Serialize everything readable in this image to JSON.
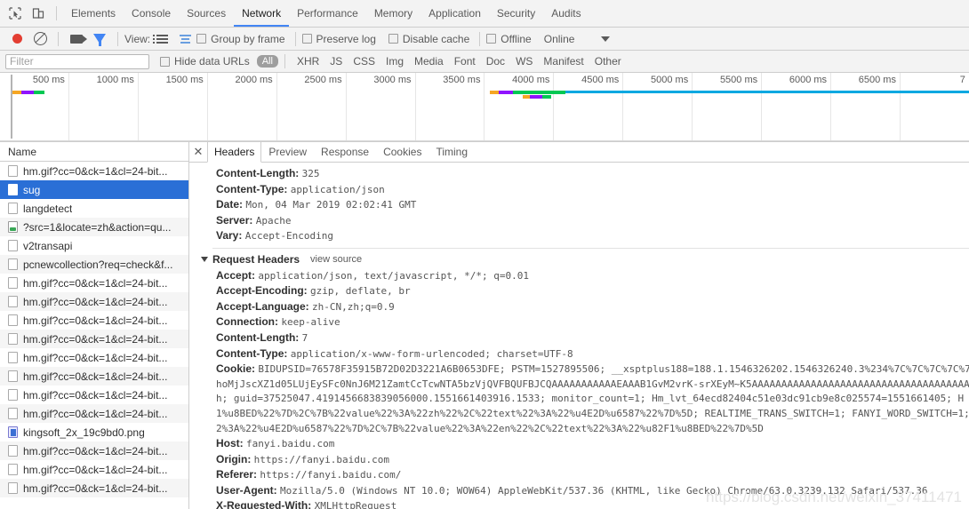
{
  "main_tabs": [
    {
      "label": "Elements",
      "active": false
    },
    {
      "label": "Console",
      "active": false
    },
    {
      "label": "Sources",
      "active": false
    },
    {
      "label": "Network",
      "active": true
    },
    {
      "label": "Performance",
      "active": false
    },
    {
      "label": "Memory",
      "active": false
    },
    {
      "label": "Application",
      "active": false
    },
    {
      "label": "Security",
      "active": false
    },
    {
      "label": "Audits",
      "active": false
    }
  ],
  "network_toolbar": {
    "record_title": "record-button",
    "clear_title": "clear-button",
    "view_label": "View:",
    "group_by_frame_label": "Group by frame",
    "preserve_log_label": "Preserve log",
    "disable_cache_label": "Disable cache",
    "offline_label": "Offline",
    "throttling_value": "Online"
  },
  "filter_bar": {
    "filter_placeholder": "Filter",
    "filter_value": "",
    "hide_data_urls_label": "Hide data URLs",
    "all_label": "All",
    "types": [
      "XHR",
      "JS",
      "CSS",
      "Img",
      "Media",
      "Font",
      "Doc",
      "WS",
      "Manifest",
      "Other"
    ]
  },
  "overview": {
    "tick_labels": [
      "500 ms",
      "1000 ms",
      "1500 ms",
      "2000 ms",
      "2500 ms",
      "3000 ms",
      "3500 ms",
      "4000 ms",
      "4500 ms",
      "5000 ms",
      "5500 ms",
      "6000 ms",
      "6500 ms",
      "7"
    ],
    "colors": {
      "orange": "#f5a623",
      "purple": "#9013fe",
      "green": "#00c853",
      "blue": "#00a8e1"
    }
  },
  "requests": {
    "column_header": "Name",
    "rows": [
      {
        "name": "hm.gif?cc=0&ck=1&cl=24-bit...",
        "icon": "file-icon",
        "selected": false
      },
      {
        "name": "sug",
        "icon": "file-icon",
        "selected": true
      },
      {
        "name": "langdetect",
        "icon": "file-icon",
        "selected": false
      },
      {
        "name": "?src=1&locate=zh&action=qu...",
        "icon": "document-icon",
        "selected": false
      },
      {
        "name": "v2transapi",
        "icon": "file-icon",
        "selected": false
      },
      {
        "name": "pcnewcollection?req=check&f...",
        "icon": "file-icon",
        "selected": false
      },
      {
        "name": "hm.gif?cc=0&ck=1&cl=24-bit...",
        "icon": "file-icon",
        "selected": false
      },
      {
        "name": "hm.gif?cc=0&ck=1&cl=24-bit...",
        "icon": "file-icon",
        "selected": false
      },
      {
        "name": "hm.gif?cc=0&ck=1&cl=24-bit...",
        "icon": "file-icon",
        "selected": false
      },
      {
        "name": "hm.gif?cc=0&ck=1&cl=24-bit...",
        "icon": "file-icon",
        "selected": false
      },
      {
        "name": "hm.gif?cc=0&ck=1&cl=24-bit...",
        "icon": "file-icon",
        "selected": false
      },
      {
        "name": "hm.gif?cc=0&ck=1&cl=24-bit...",
        "icon": "file-icon",
        "selected": false
      },
      {
        "name": "hm.gif?cc=0&ck=1&cl=24-bit...",
        "icon": "file-icon",
        "selected": false
      },
      {
        "name": "hm.gif?cc=0&ck=1&cl=24-bit...",
        "icon": "file-icon",
        "selected": false
      },
      {
        "name": "kingsoft_2x_19c9bd0.png",
        "icon": "image-icon",
        "selected": false
      },
      {
        "name": "hm.gif?cc=0&ck=1&cl=24-bit...",
        "icon": "file-icon",
        "selected": false
      },
      {
        "name": "hm.gif?cc=0&ck=1&cl=24-bit...",
        "icon": "file-icon",
        "selected": false
      },
      {
        "name": "hm.gif?cc=0&ck=1&cl=24-bit...",
        "icon": "file-icon",
        "selected": false
      }
    ]
  },
  "detail": {
    "tabs": [
      {
        "label": "Headers",
        "active": true
      },
      {
        "label": "Preview",
        "active": false
      },
      {
        "label": "Response",
        "active": false
      },
      {
        "label": "Cookies",
        "active": false
      },
      {
        "label": "Timing",
        "active": false
      }
    ],
    "response_headers": [
      {
        "name": "Content-Length:",
        "value": "325"
      },
      {
        "name": "Content-Type:",
        "value": "application/json"
      },
      {
        "name": "Date:",
        "value": "Mon, 04 Mar 2019 02:02:41 GMT"
      },
      {
        "name": "Server:",
        "value": "Apache"
      },
      {
        "name": "Vary:",
        "value": "Accept-Encoding"
      }
    ],
    "request_headers_section": {
      "title": "Request Headers",
      "view_source": "view source"
    },
    "request_headers": [
      {
        "name": "Accept:",
        "value": "application/json, text/javascript, */*; q=0.01"
      },
      {
        "name": "Accept-Encoding:",
        "value": "gzip, deflate, br"
      },
      {
        "name": "Accept-Language:",
        "value": "zh-CN,zh;q=0.9"
      },
      {
        "name": "Connection:",
        "value": "keep-alive"
      },
      {
        "name": "Content-Length:",
        "value": "7"
      },
      {
        "name": "Content-Type:",
        "value": "application/x-www-form-urlencoded; charset=UTF-8"
      }
    ],
    "cookie_header": {
      "name": "Cookie:",
      "lines": [
        "BIDUPSID=76578F35915B72D02D3221A6B0653DFE; PSTM=1527895506; __xsptplus188=188.1.1546326202.1546326240.3%234%7C%7C%7C%7C%7C%7C",
        "hoMjJscXZ1d05LUjEySFc0NnJ6M21ZamtCcTcwNTA5bzVjQVFBQUFBJCQAAAAAAAAAAAEAAAB1GvM2vrK-srXEyM~K5AAAAAAAAAAAAAAAAAAAAAAAAAAAAAAAAAAAAAAAA",
        "h;   guid=37525047.4191456683839056000.1551661403916.1533; monitor_count=1; Hm_lvt_64ecd82404c51e03dc91cb9e8c025574=1551661405; H",
        "1%u8BED%22%7D%2C%7B%22value%22%3A%22zh%22%2C%22text%22%3A%22%u4E2D%u6587%22%7D%5D; REALTIME_TRANS_SWITCH=1; FANYI_WORD_SWITCH=1;",
        "2%3A%22%u4E2D%u6587%22%7D%2C%7B%22value%22%3A%22en%22%2C%22text%22%3A%22%u82F1%u8BED%22%7D%5D"
      ]
    },
    "tail_headers": [
      {
        "name": "Host:",
        "value": "fanyi.baidu.com"
      },
      {
        "name": "Origin:",
        "value": "https://fanyi.baidu.com"
      },
      {
        "name": "Referer:",
        "value": "https://fanyi.baidu.com/"
      },
      {
        "name": "User-Agent:",
        "value": "Mozilla/5.0 (Windows NT 10.0; WOW64) AppleWebKit/537.36 (KHTML, like Gecko) Chrome/63.0.3239.132 Safari/537.36"
      },
      {
        "name": "X-Requested-With:",
        "value": "XMLHttpRequest"
      }
    ]
  },
  "watermark": "https://blog.csdn.net/weixin_37411471"
}
